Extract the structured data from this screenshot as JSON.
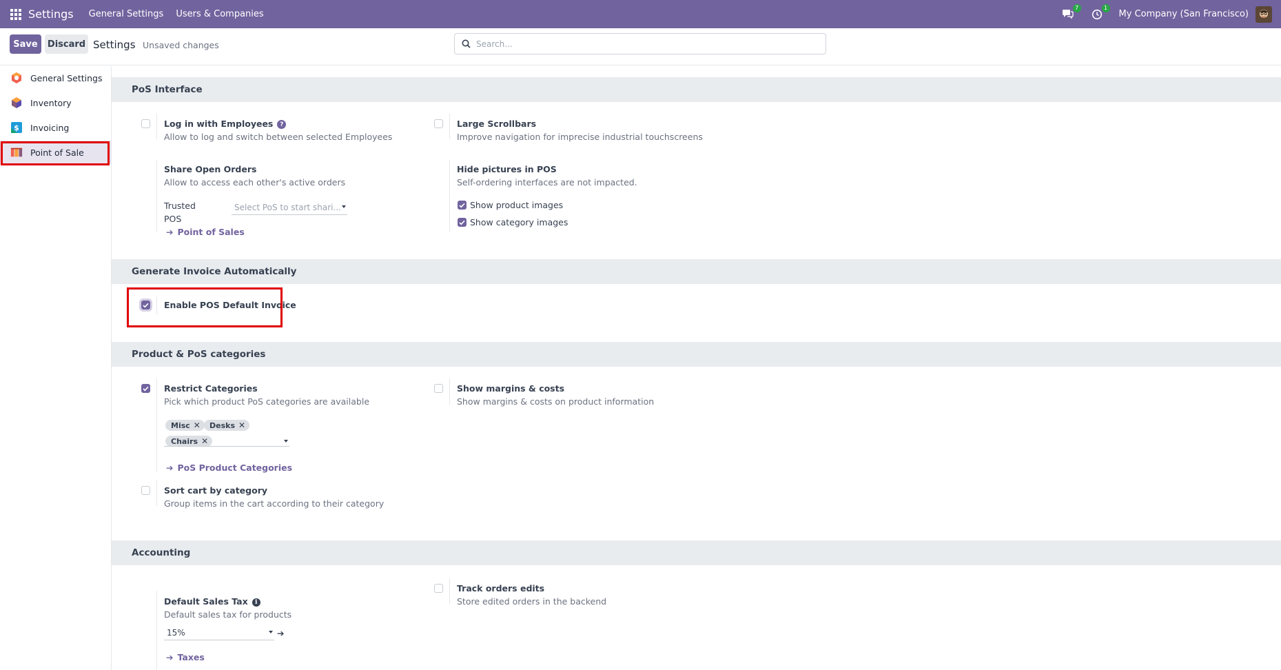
{
  "topbar": {
    "brand": "Settings",
    "nav": [
      "General Settings",
      "Users & Companies"
    ],
    "messages_badge": "7",
    "activity_badge": "1",
    "company": "My Company (San Francisco)"
  },
  "controlbar": {
    "save_label": "Save",
    "discard_label": "Discard",
    "title": "Settings",
    "status": "Unsaved changes",
    "search_placeholder": "Search..."
  },
  "sidebar": {
    "items": [
      {
        "label": "General Settings",
        "icon": "general-settings-icon"
      },
      {
        "label": "Inventory",
        "icon": "inventory-icon"
      },
      {
        "label": "Invoicing",
        "icon": "invoicing-icon"
      },
      {
        "label": "Point of Sale",
        "icon": "point-of-sale-icon",
        "active": true
      }
    ]
  },
  "sections": {
    "pos_interface": {
      "header": "PoS Interface",
      "login_employees": {
        "title": "Log in with Employees",
        "desc": "Allow to log and switch between selected Employees",
        "checked": false
      },
      "large_scrollbars": {
        "title": "Large Scrollbars",
        "desc": "Improve navigation for imprecise industrial touchscreens",
        "checked": false
      },
      "share_orders": {
        "title": "Share Open Orders",
        "desc": "Allow to access each other's active orders",
        "trusted_label_1": "Trusted",
        "trusted_label_2": "POS",
        "trusted_placeholder": "Select PoS to start shari...",
        "link": "Point of Sales"
      },
      "hide_pictures": {
        "title": "Hide pictures in POS",
        "desc": "Self-ordering interfaces are not impacted.",
        "opt_product": "Show product images",
        "opt_category": "Show category images",
        "opt_product_checked": true,
        "opt_category_checked": true
      }
    },
    "invoice_auto": {
      "header": "Generate Invoice Automatically",
      "enable_default": {
        "title": "Enable POS Default Invoice",
        "checked": true
      }
    },
    "categories": {
      "header": "Product & PoS categories",
      "restrict": {
        "title": "Restrict Categories",
        "desc": "Pick which product PoS categories are available",
        "checked": true,
        "tags": [
          "Misc",
          "Desks",
          "Chairs"
        ],
        "link": "PoS Product Categories"
      },
      "margins": {
        "title": "Show margins & costs",
        "desc": "Show margins & costs on product information",
        "checked": false
      },
      "sort_cart": {
        "title": "Sort cart by category",
        "desc": "Group items in the cart according to their category",
        "checked": false
      }
    },
    "accounting": {
      "header": "Accounting",
      "sales_tax": {
        "title": "Default Sales Tax",
        "desc": "Default sales tax for products",
        "value": "15%",
        "link": "Taxes"
      },
      "track_edits": {
        "title": "Track orders edits",
        "desc": "Store edited orders in the backend",
        "checked": false
      }
    }
  },
  "colors": {
    "brand": "#71639e",
    "highlight": "#e00000",
    "section_bg": "#e9ecef"
  }
}
